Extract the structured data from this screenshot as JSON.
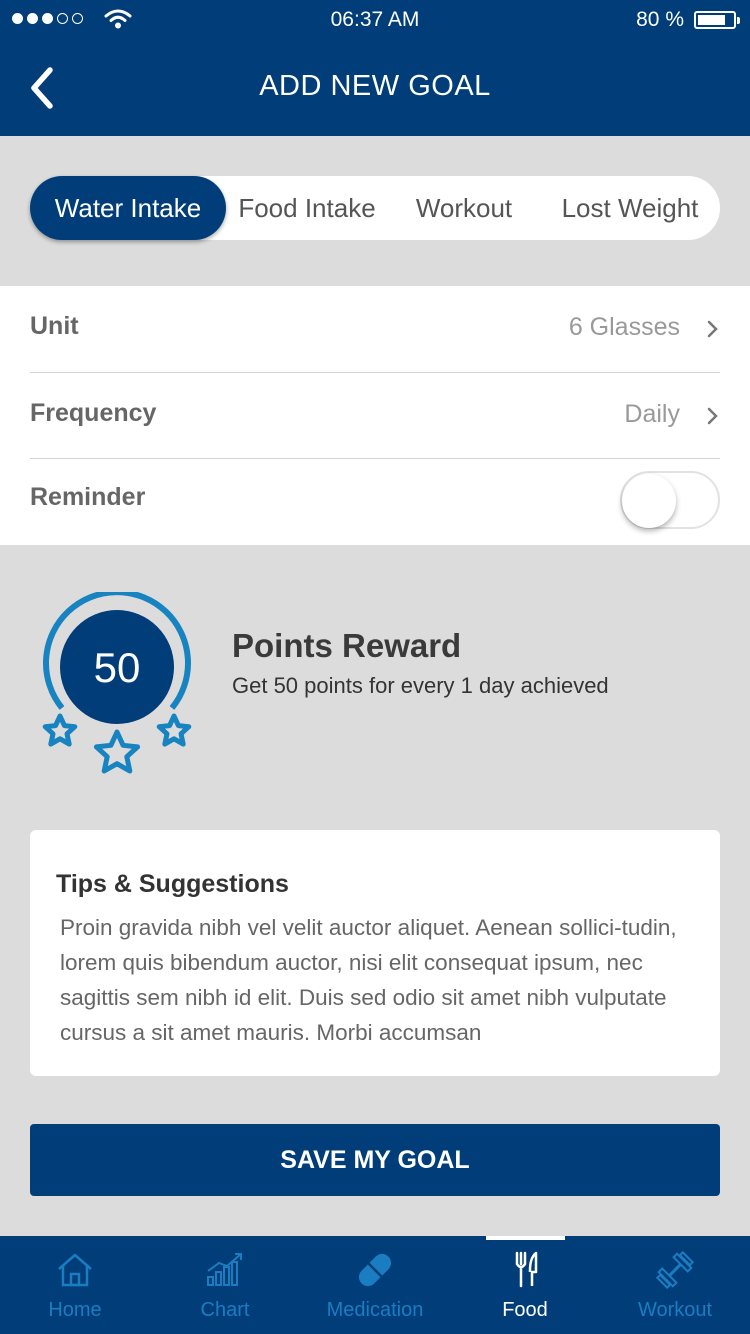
{
  "status_bar": {
    "time": "06:37 AM",
    "battery": "80 %",
    "battery_level": 0.8
  },
  "nav": {
    "title": "ADD NEW GOAL"
  },
  "segments": [
    {
      "label": "Water Intake",
      "active": true
    },
    {
      "label": "Food Intake",
      "active": false
    },
    {
      "label": "Workout",
      "active": false
    },
    {
      "label": "Lost Weight",
      "active": false
    }
  ],
  "settings": {
    "unit": {
      "label": "Unit",
      "value": "6 Glasses"
    },
    "frequency": {
      "label": "Frequency",
      "value": "Daily"
    },
    "reminder": {
      "label": "Reminder",
      "on": false
    }
  },
  "reward": {
    "points": "50",
    "title": "Points Reward",
    "subtitle": "Get 50 points  for every 1 day achieved"
  },
  "tips": {
    "title": "Tips & Suggestions",
    "body": "Proin gravida nibh vel velit auctor aliquet. Aenean sollici-tudin, lorem quis bibendum auctor, nisi elit consequat ipsum, nec sagittis sem nibh id elit. Duis sed odio sit amet nibh vulputate cursus a sit amet mauris. Morbi accumsan"
  },
  "save_button": "SAVE MY GOAL",
  "tabbar": [
    {
      "label": "Home",
      "icon": "home-icon",
      "active": false
    },
    {
      "label": "Chart",
      "icon": "chart-icon",
      "active": false
    },
    {
      "label": "Medication",
      "icon": "pill-icon",
      "active": false
    },
    {
      "label": "Food",
      "icon": "fork-knife-icon",
      "active": true
    },
    {
      "label": "Workout",
      "icon": "dumbbell-icon",
      "active": false
    }
  ],
  "colors": {
    "primary": "#003d79",
    "accent": "#1b7dc1",
    "background": "#dddcdd"
  }
}
